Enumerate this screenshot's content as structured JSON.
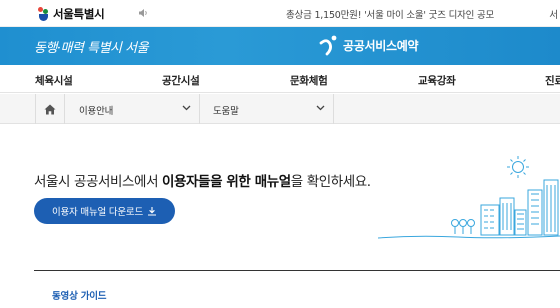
{
  "header": {
    "logo_text": "서울특별시",
    "notice": "총상금 1,150만원! '서울 마이 소울' 굿즈 디자인 공모",
    "right_text": "서",
    "icons": {
      "logo": "seoul-logo-icon",
      "speaker": "speaker-icon"
    }
  },
  "banner": {
    "slogan": "동행·매력 특별시 서울",
    "service_name": "공공서비스예약",
    "bg_color": "#1f8fd0",
    "icons": {
      "service": "reservation-logo-icon"
    }
  },
  "nav": {
    "items": [
      {
        "label": "체육시설"
      },
      {
        "label": "공간시설"
      },
      {
        "label": "문화체험"
      },
      {
        "label": "교육강좌"
      },
      {
        "label": "진료"
      }
    ]
  },
  "breadcrumb": {
    "home_icon": "home-icon",
    "items": [
      {
        "label": "이용안내"
      },
      {
        "label": "도움말"
      }
    ]
  },
  "intro": {
    "text_before": "서울시 공공서비스에서 ",
    "text_bold": "이용자들을 위한 매뉴얼",
    "text_after": "을 확인하세요.",
    "button_label": "이용자 매뉴얼 다운로드",
    "button_color": "#1d5fb3",
    "download_icon": "download-icon"
  },
  "section": {
    "title": "동영상 가이드"
  }
}
